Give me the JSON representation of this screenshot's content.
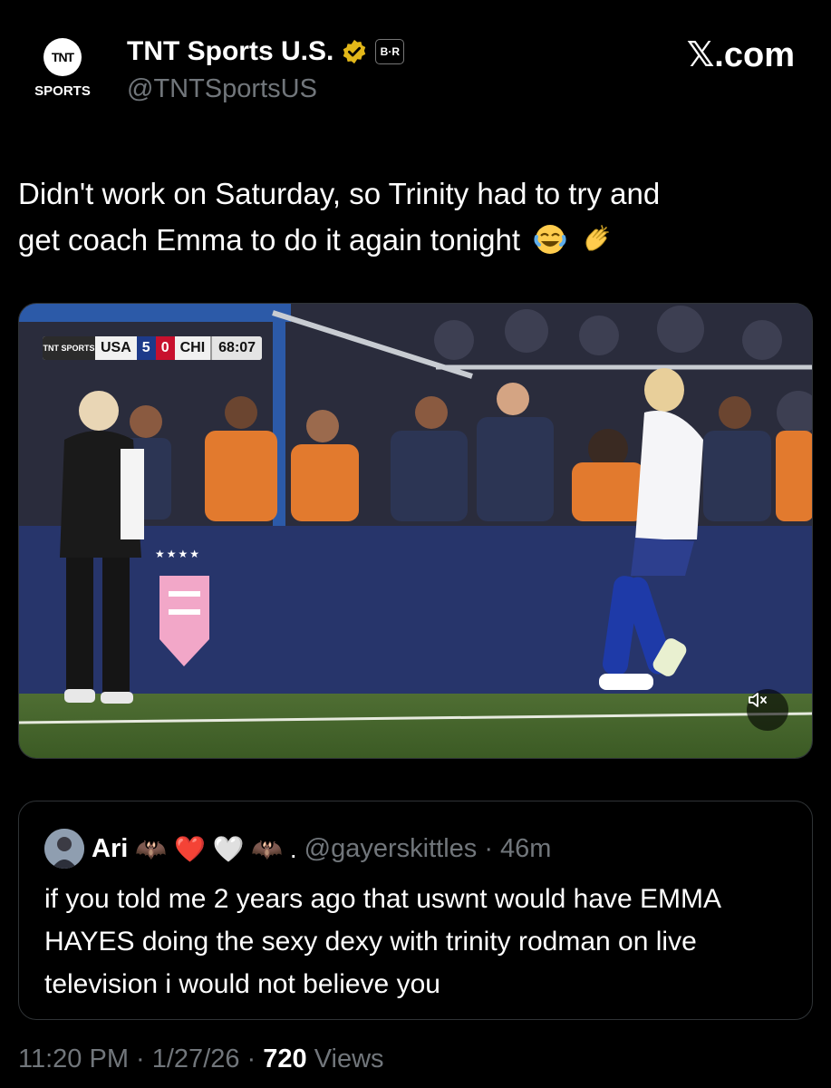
{
  "header": {
    "avatar_line1": "TNT",
    "avatar_line2": "SPORTS",
    "display_name": "TNT Sports U.S.",
    "badge_text": "B·R",
    "handle": "@TNTSportsUS",
    "site_label": "𝕏.com"
  },
  "tweet": {
    "line1": "Didn't work on Saturday, so Trinity had to try and",
    "line2": "get coach Emma to do it again tonight",
    "emojis": [
      "face-with-tears-of-joy-icon",
      "clapping-hands-icon"
    ]
  },
  "video": {
    "scorebug": {
      "logo": "TNT SPORTS",
      "team1": "USA",
      "score1": "5",
      "score2": "0",
      "team2": "CHI",
      "clock": "68:07"
    },
    "mute_icon": "speaker-muted-icon"
  },
  "quote": {
    "name": "Ari",
    "name_emojis": "🦇 ❤️ 🤍 🦇 .",
    "handle_time": "@gayerskittles · 46m",
    "text": "if you told me 2 years ago that uswnt would have EMMA HAYES doing the sexy dexy with trinity rodman on live television i would not believe you"
  },
  "footer": {
    "time_date": "11:20 PM · 1/27/26 · ",
    "views_count": "720",
    "views_label": " Views"
  },
  "colors": {
    "background": "#000000",
    "text_primary": "#e7e9ea",
    "text_secondary": "#71767b",
    "border": "#2f3336",
    "verified_gold": "#e2b719"
  }
}
